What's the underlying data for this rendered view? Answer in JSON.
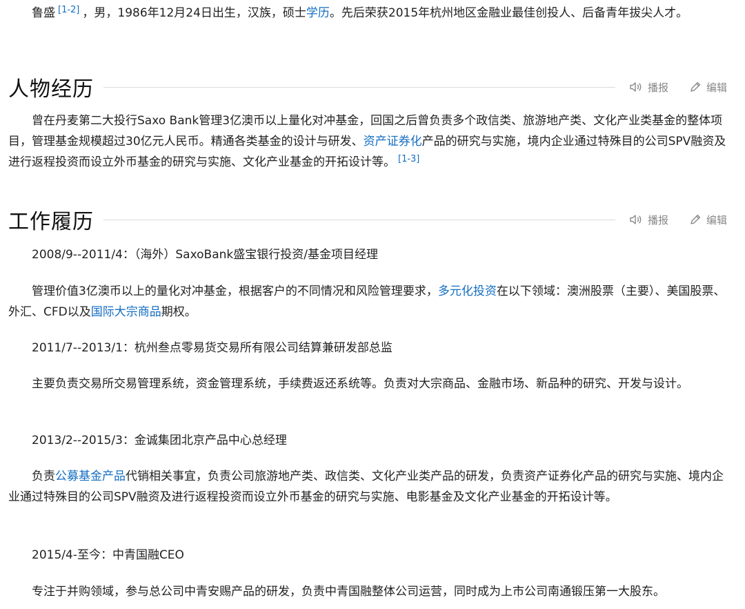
{
  "intro": {
    "name": "鲁盛",
    "ref": "[1-2]",
    "text_1": "，男，1986年12月24日出生，汉族，硕士",
    "link": "学历",
    "text_2": "。先后荣获2015年杭州地区金融业最佳创投人、后备青年拔尖人才。"
  },
  "actions": {
    "broadcast": "播报",
    "edit": "编辑"
  },
  "icons": {
    "broadcast": "speaker-icon",
    "edit": "pencil-icon"
  },
  "colors": {
    "link": "#136ec2",
    "muted": "#888888"
  },
  "section1": {
    "title": "人物经历",
    "para": {
      "t1": "曾在丹麦第二大投行Saxo Bank管理3亿澳币以上量化对冲基金，回国之后曾负责多个政信类、旅游地产类、文化产业类基金的整体项目，管理基金规模超过30亿元人民币。精通各类基金的设计与研发、",
      "link": "资产证券化",
      "t2": "产品的研究与实施，境内企业通过特殊目的公司SPV融资及进行返程投资而设立外币基金的研究与实施、文化产业基金的开拓设计等。",
      "ref": "[1-3]"
    }
  },
  "section2": {
    "title": "工作履历",
    "job1": {
      "period": "2008/9--2011/4：（海外）SaxoBank盛宝银行投资/基金项目经理"
    },
    "job1_desc": {
      "t1": "管理价值3亿澳币以上的量化对冲基金，根据客户的不同情况和风险管理要求，",
      "link1": "多元化投资",
      "t2": "在以下领域：澳洲股票（主要）、美国股票、外汇、CFD以及",
      "link2": "国际大宗商品",
      "t3": "期权。"
    },
    "job2": {
      "period": "2011/7--2013/1：杭州叁点零易货交易所有限公司结算兼研发部总监"
    },
    "job2_desc": "主要负责交易所交易管理系统，资金管理系统，手续费返还系统等。负责对大宗商品、金融市场、新品种的研究、开发与设计。",
    "job3": {
      "period": "2013/2--2015/3：金诚集团北京产品中心总经理"
    },
    "job3_desc": {
      "t1": "负责",
      "link": "公募基金产品",
      "t2": "代销相关事宜，负责公司旅游地产类、政信类、文化产业类产品的研发，负责资产证券化产品的研究与实施、境内企业通过特殊目的公司SPV融资及进行返程投资而设立外币基金的研究与实施、电影基金及文化产业基金的开拓设计等。"
    },
    "job4": {
      "period": "2015/4-至今：中青国融CEO"
    },
    "job4_desc": "专注于并购领域，参与总公司中青安赐产品的研发，负责中青国融整体公司运营，同时成为上市公司南通锻压第一大股东。"
  }
}
